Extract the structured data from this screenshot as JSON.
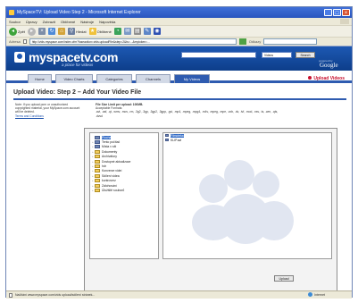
{
  "window": {
    "title": "MySpaceTV: Upload Video Step 2 - Microsoft Internet Explorer"
  },
  "menubar": {
    "items": [
      "Soubor",
      "Úpravy",
      "Zobrazit",
      "Oblíbené",
      "Nástroje",
      "Nápověda"
    ]
  },
  "toolbar": {
    "back_label": "Zpět",
    "search_label": "Hledat",
    "favorites_label": "Oblíbené"
  },
  "addressbar": {
    "label": "Adresa",
    "url": "http://vids.myspace.com/index.cfm?fuseaction=vids.uploadFile&step=2&ts=...&mytoken=...",
    "links_label": "Odkazy"
  },
  "site": {
    "logo": "myspacetv.com",
    "tagline": "a place for videos",
    "search_placeholder": "",
    "search_scope": "Videos",
    "search_button": "Search",
    "powered_by": "powered by",
    "google": "Google",
    "upload_link": "Upload Videos"
  },
  "tabs": [
    {
      "label": "Home"
    },
    {
      "label": "Video Charts"
    },
    {
      "label": "Categories"
    },
    {
      "label": "Channels"
    },
    {
      "label": "My Videos"
    }
  ],
  "section": {
    "title": "Upload Video: Step 2 – Add Your Video File"
  },
  "note": {
    "text": "Note: If you upload porn or unauthorized copyrighted material, your MySpace.com account will be deleted.",
    "terms_link": "Terms and Conditions"
  },
  "file_info": {
    "limit": "File Size Limit per upload: 100MB.",
    "formats_label": "Acceptable Formats:",
    "formats": ".avi, .asf, .qt, .wmv, .mov, .rm, .3g2, .3gp, .3gp2, .3gpp, .gvi, .mp4, .mpeg, .mpg4, .m4v, .mpeg, .mpe, .vob, .dv, .ivf, .mod, .nsv, .ts, .wm, .qts, .dvsd"
  },
  "picker": {
    "tree": [
      {
        "label": "Plocha",
        "selected": true,
        "expander": ""
      },
      {
        "label": "Tento počítač",
        "selected": false,
        "expander": "+"
      },
      {
        "label": "Místa v síti",
        "selected": false,
        "expander": "+"
      },
      {
        "label": "Dokumenty",
        "selected": false,
        "expander": "+"
      },
      {
        "label": "Archivátory",
        "selected": false,
        "expander": "+"
      },
      {
        "label": "Dostupné aktualizace",
        "selected": false,
        "expander": "+"
      },
      {
        "label": "hdr",
        "selected": false,
        "expander": "+"
      },
      {
        "label": "Konverze videí",
        "selected": false,
        "expander": "+"
      },
      {
        "label": "Sdílení videa",
        "selected": false,
        "expander": "+"
      },
      {
        "label": "kontroverz",
        "selected": false,
        "expander": "+"
      },
      {
        "label": "Zálohování",
        "selected": false,
        "expander": "+"
      },
      {
        "label": "Úložiště souborů",
        "selected": false,
        "expander": "+"
      }
    ],
    "files": [
      {
        "label": "Filmoteka",
        "highlight": true
      },
      {
        "label": "KLIP.avi",
        "highlight": false
      }
    ],
    "upload_button": "Upload"
  },
  "statusbar": {
    "text": "Načítání www.myspace.com/vids upload/sdílení stránek...",
    "zone": "Internet"
  }
}
